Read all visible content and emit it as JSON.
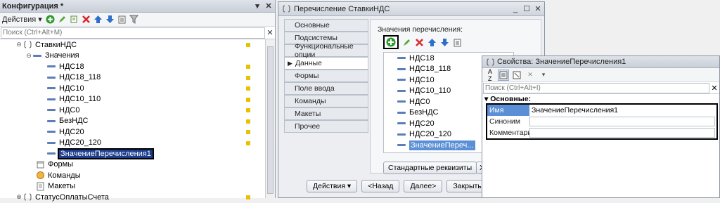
{
  "config_panel": {
    "title": "Конфигурация *",
    "actions_label": "Действия",
    "search_placeholder": "Поиск (Ctrl+Alt+M)",
    "tree": {
      "root": "СтавкиНДС",
      "values_group": "Значения",
      "values": [
        "НДС18",
        "НДС18_118",
        "НДС10",
        "НДС10_110",
        "НДС0",
        "БезНДС",
        "НДС20",
        "НДС20_120"
      ],
      "new_value": "ЗначениеПеречисления1",
      "forms": "Формы",
      "commands": "Команды",
      "templates": "Макеты",
      "next_enum": "СтатусОплатыСчета"
    }
  },
  "enum_window": {
    "title": "Перечисление СтавкиНДС",
    "tabs": [
      "Основные",
      "Подсистемы",
      "Функциональные опции",
      "Данные",
      "Формы",
      "Поле ввода",
      "Команды",
      "Макеты",
      "Прочее"
    ],
    "active_tab_index": 3,
    "values_header": "Значения перечисления:",
    "values": [
      "НДС18",
      "НДС18_118",
      "НДС10",
      "НДС10_110",
      "НДС0",
      "БезНДС",
      "НДС20",
      "НДС20_120",
      "ЗначениеПереч..."
    ],
    "std_attrs_button": "Стандартные реквизиты",
    "std_button2": "Ха",
    "bottom": {
      "actions": "Действия",
      "back": "<Назад",
      "next": "Далее>",
      "close": "Закрыть"
    }
  },
  "props_window": {
    "title": "Свойства: ЗначениеПеречисления1",
    "search_placeholder": "Поиск (Ctrl+Alt+I)",
    "group": "Основные:",
    "rows": [
      {
        "name": "Имя",
        "value": "ЗначениеПеречисления1"
      },
      {
        "name": "Синоним",
        "value": ""
      },
      {
        "name": "Комментарий",
        "value": ""
      }
    ]
  },
  "colors": {
    "selection": "#1c3c8c",
    "list_selection": "#5b8fd6",
    "add_green": "#2e9a2e",
    "delete_red": "#d8262a",
    "arrow_blue": "#2f6fc9",
    "marker_yellow": "#e8c100"
  }
}
